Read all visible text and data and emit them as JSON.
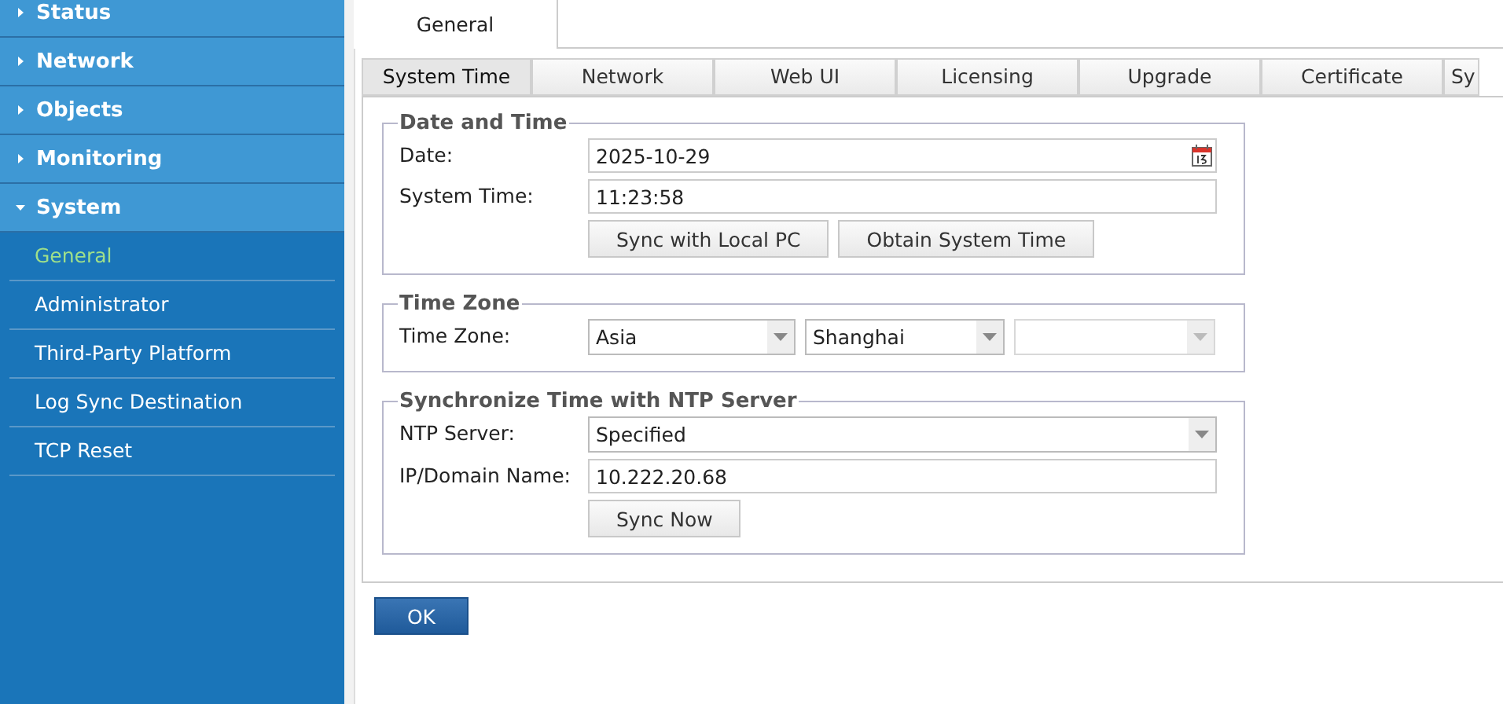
{
  "sidebar": {
    "items": [
      {
        "label": "Status",
        "expanded": false
      },
      {
        "label": "Network",
        "expanded": false
      },
      {
        "label": "Objects",
        "expanded": false
      },
      {
        "label": "Monitoring",
        "expanded": false
      },
      {
        "label": "System",
        "expanded": true,
        "children": [
          {
            "label": "General",
            "selected": true
          },
          {
            "label": "Administrator",
            "selected": false
          },
          {
            "label": "Third-Party Platform",
            "selected": false
          },
          {
            "label": "Log Sync Destination",
            "selected": false
          },
          {
            "label": "TCP Reset",
            "selected": false
          }
        ]
      }
    ]
  },
  "page_tabs": [
    {
      "label": "General",
      "selected": true
    }
  ],
  "sub_tabs": [
    {
      "label": "System Time",
      "selected": true
    },
    {
      "label": "Network",
      "selected": false
    },
    {
      "label": "Web UI",
      "selected": false
    },
    {
      "label": "Licensing",
      "selected": false
    },
    {
      "label": "Upgrade",
      "selected": false
    },
    {
      "label": "Certificate",
      "selected": false
    },
    {
      "label": "Sy",
      "selected": false
    }
  ],
  "sections": [
    {
      "title": "Date and Time",
      "rows": [
        {
          "kind": "date",
          "label": "Date:",
          "value": "2025-10-29"
        },
        {
          "kind": "text",
          "label": "System Time:",
          "value": "11:23:58"
        },
        {
          "kind": "buttons",
          "buttons": [
            "Sync with Local PC",
            "Obtain System Time"
          ]
        }
      ]
    },
    {
      "title": "Time Zone",
      "rows": [
        {
          "kind": "selects",
          "label": "Time Zone:",
          "selects": [
            {
              "value": "Asia",
              "disabled": false
            },
            {
              "value": "Shanghai",
              "disabled": false
            },
            {
              "disabled": true
            }
          ]
        }
      ]
    },
    {
      "title": "Synchronize Time with NTP Server",
      "rows": [
        {
          "kind": "select",
          "label": "NTP Server:",
          "value": "Specified"
        },
        {
          "kind": "text",
          "label": "IP/Domain Name:",
          "value": "10.222.20.68"
        },
        {
          "kind": "buttons",
          "buttons": [
            "Sync Now"
          ]
        }
      ]
    }
  ],
  "ok_button": "OK"
}
